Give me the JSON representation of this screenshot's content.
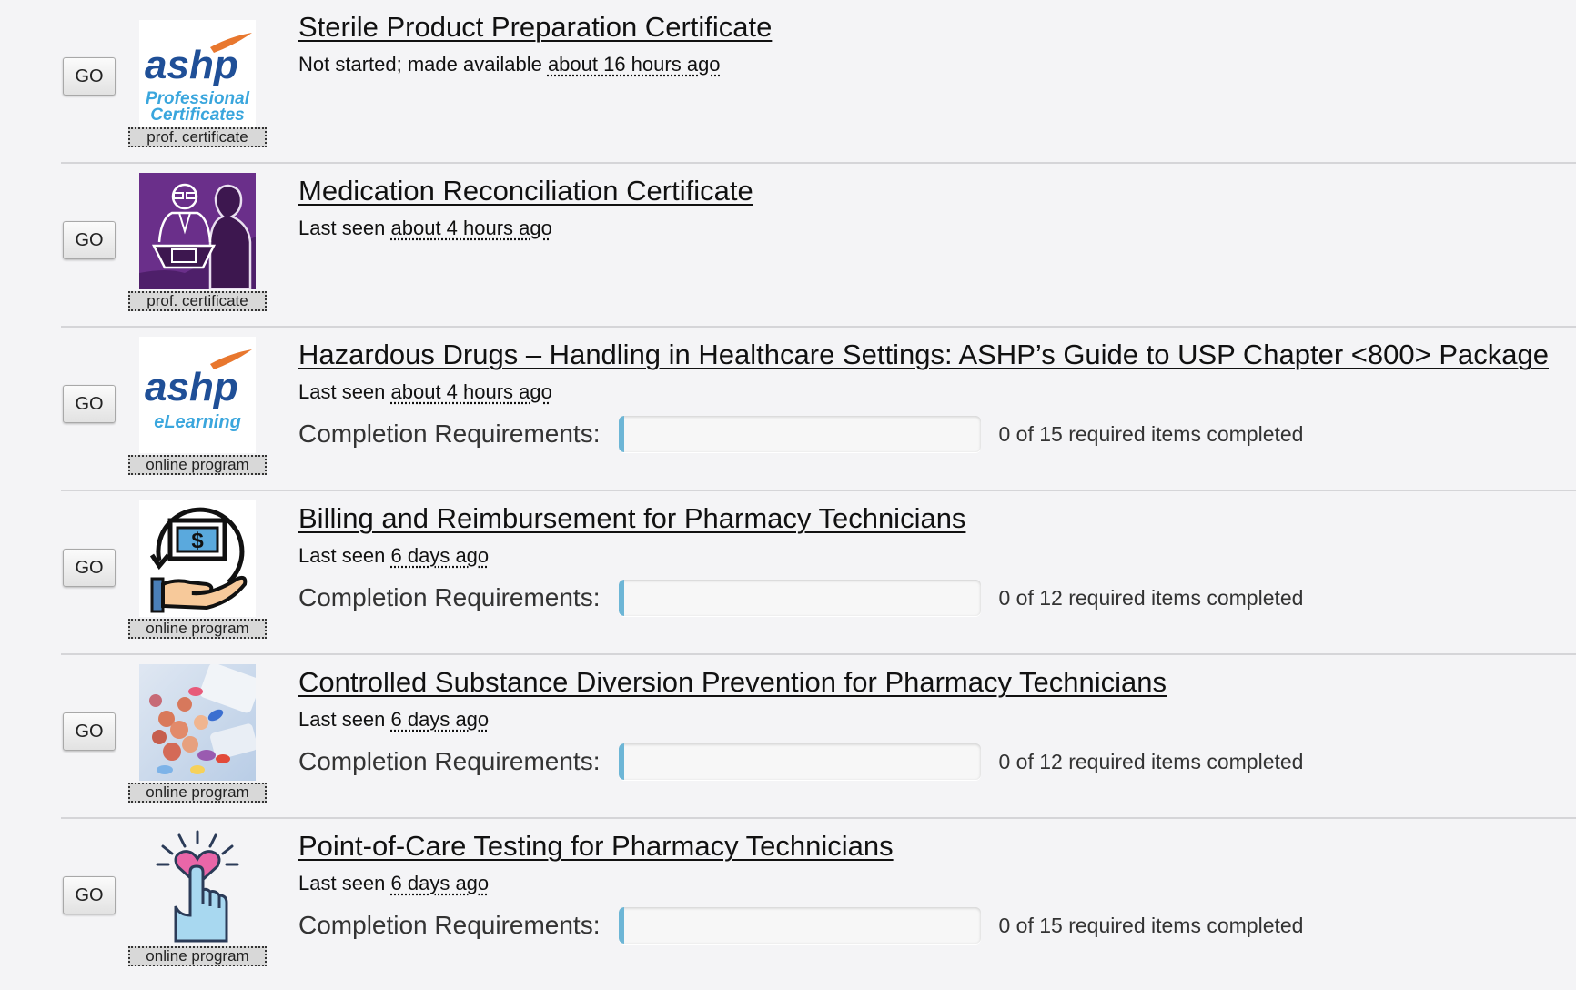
{
  "go_label": "GO",
  "items": [
    {
      "title": "Sterile Product Preparation Certificate",
      "status_prefix": "Not started; made available ",
      "status_time": "about 16 hours ago",
      "type_label": "prof. certificate",
      "thumb_icon": "ashp-professional-certificates-logo",
      "thumb_text": {
        "brand": "ashp",
        "line1": "Professional",
        "line2": "Certificates"
      },
      "has_completion": false
    },
    {
      "title": "Medication Reconciliation Certificate",
      "status_prefix": "Last seen ",
      "status_time": "about 4 hours ago",
      "type_label": "prof. certificate",
      "thumb_icon": "pharmacist-consultation-icon",
      "has_completion": false
    },
    {
      "title": "Hazardous Drugs – Handling in Healthcare Settings: ASHP’s Guide to USP Chapter <800> Package",
      "status_prefix": "Last seen ",
      "status_time": "about 4 hours ago",
      "type_label": "online program",
      "thumb_icon": "ashp-elearning-logo",
      "thumb_text": {
        "brand": "ashp",
        "line1": "eLearning"
      },
      "has_completion": true,
      "completion_label": "Completion Requirements:",
      "completion_text": "0 of 15 required items completed",
      "completed": 0,
      "required": 15
    },
    {
      "title": "Billing and Reimbursement for Pharmacy Technicians",
      "status_prefix": "Last seen ",
      "status_time": "6 days ago",
      "type_label": "online program",
      "thumb_icon": "hand-money-icon",
      "thumb_text": {
        "symbol": "$"
      },
      "has_completion": true,
      "completion_label": "Completion Requirements:",
      "completion_text": "0 of 12 required items completed",
      "completed": 0,
      "required": 12
    },
    {
      "title": "Controlled Substance Diversion Prevention for Pharmacy Technicians",
      "status_prefix": "Last seen ",
      "status_time": "6 days ago",
      "type_label": "online program",
      "thumb_icon": "pills-photo",
      "has_completion": true,
      "completion_label": "Completion Requirements:",
      "completion_text": "0 of 12 required items completed",
      "completed": 0,
      "required": 12
    },
    {
      "title": "Point-of-Care Testing for Pharmacy Technicians",
      "status_prefix": "Last seen ",
      "status_time": "6 days ago",
      "type_label": "online program",
      "thumb_icon": "finger-prick-heart-icon",
      "has_completion": true,
      "completion_label": "Completion Requirements:",
      "completion_text": "0 of 15 required items completed",
      "completed": 0,
      "required": 15
    }
  ],
  "colors": {
    "ashp_blue": "#1f4f97",
    "ashp_orange": "#e8772e",
    "ashp_light_blue": "#3aa6dd",
    "purple": "#6a2f8a",
    "progress_fill": "#6db6d6"
  }
}
